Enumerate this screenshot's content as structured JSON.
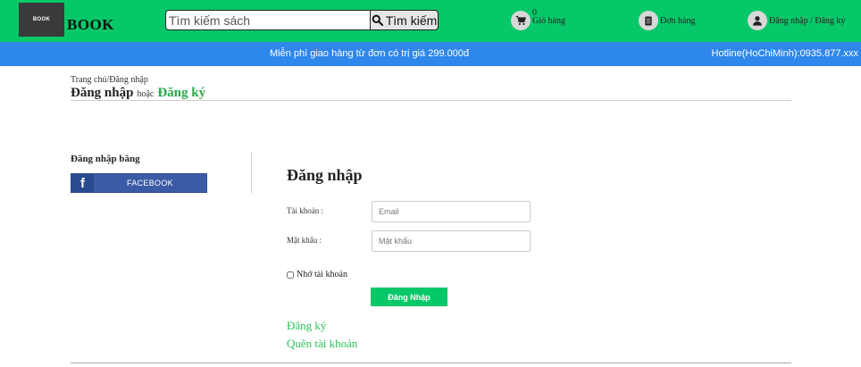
{
  "header": {
    "logo_mark": "BOOK",
    "logo_text": "BOOK",
    "search": {
      "placeholder": "Tìm kiếm sách",
      "button_label": "Tìm kiếm"
    },
    "cart": {
      "count": "0",
      "label": "Giỏ hàng",
      "icon": "cart-icon"
    },
    "orders": {
      "label": "Đơn hàng",
      "icon": "receipt-icon"
    },
    "account": {
      "label": "Đăng nhập / Đăng ký",
      "icon": "user-icon"
    },
    "colors": {
      "topbar": "#07c868",
      "promo_bar": "#2e87ea"
    }
  },
  "promo": {
    "message": "Miễn phí giao hàng từ đơn có trị giá 299.000đ",
    "hotline": "Hotline(HoChiMinh):0935.877.xxx"
  },
  "breadcrumb": "Trang chủ/Đăng nhập",
  "page_title": {
    "login": "Đăng nhập",
    "or": "hoặc",
    "register": "Đăng ký"
  },
  "social": {
    "title": "Đăng nhập bằng",
    "facebook_label": "FACEBOOK",
    "facebook_icon": "f"
  },
  "form": {
    "title": "Đăng nhập",
    "username_label": "Tài khoản :",
    "username_placeholder": "Email",
    "password_label": "Mật khẩu :",
    "password_placeholder": "Mật khẩu",
    "remember_label": "Nhớ tài khoản",
    "submit_label": "Đăng Nhập"
  },
  "links": {
    "register": "Đăng ký",
    "forgot": "Quên tài khoản"
  }
}
